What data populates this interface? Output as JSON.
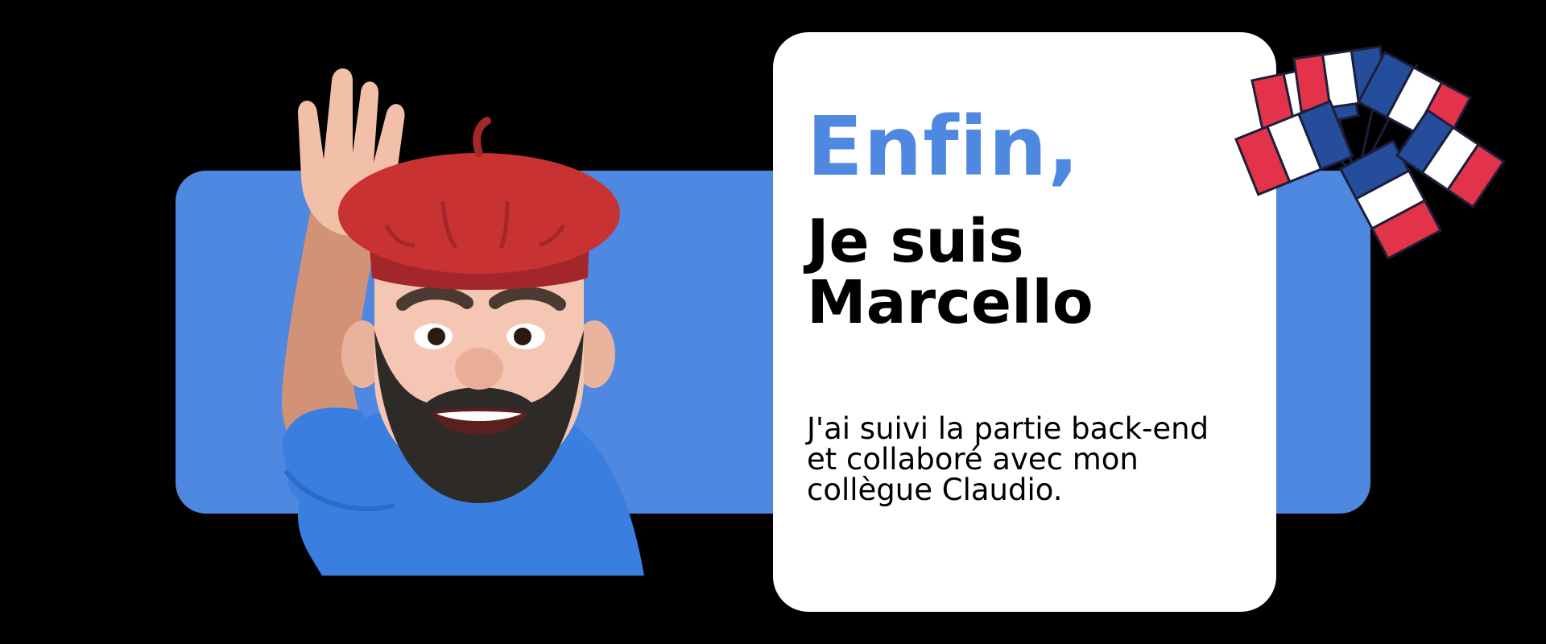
{
  "intro": {
    "accent": "Enfin,",
    "name": "Je suis Marcello",
    "bio": "J'ai suivi la partie back-end et collaboré avec mon collègue Claudio."
  },
  "illustrations": {
    "avatar": "waving-memoji-with-red-beret",
    "flags": "french-flags-fan"
  },
  "colors": {
    "background": "#000000",
    "accent_blue": "#4e88e1",
    "card": "#ffffff",
    "beret_red": "#c93233",
    "flag_blue": "#244d9c",
    "flag_red": "#e3334a"
  }
}
